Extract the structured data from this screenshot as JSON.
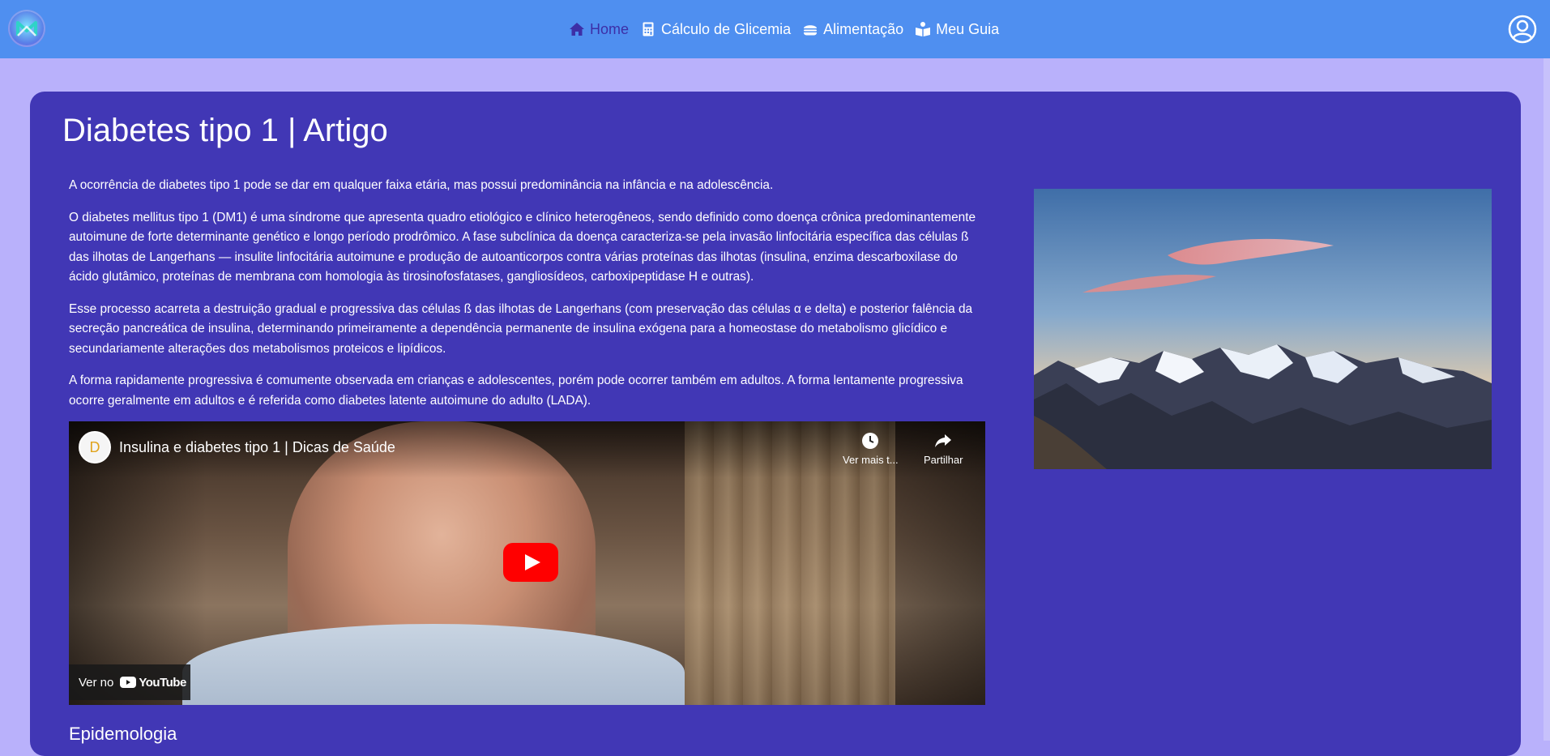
{
  "nav": {
    "items": [
      {
        "label": "Home",
        "icon": "home-icon",
        "active": true
      },
      {
        "label": "Cálculo de Glicemia",
        "icon": "calculator-icon",
        "active": false
      },
      {
        "label": "Alimentação",
        "icon": "burger-icon",
        "active": false
      },
      {
        "label": "Meu Guia",
        "icon": "guide-book-icon",
        "active": false
      }
    ],
    "logo_icon": "app-logo-icon",
    "profile_icon": "user-circle-icon"
  },
  "article": {
    "title": "Diabetes tipo 1 | Artigo",
    "paragraphs": [
      "A ocorrência de diabetes tipo 1 pode se dar em qualquer faixa etária, mas possui predominância na infância e na adolescência.",
      "O diabetes mellitus tipo 1 (DM1) é uma síndrome que apresenta quadro etiológico e clínico heterogêneos, sendo definido como doença crônica predominantemente autoimune de forte determinante genético e longo período prodrômico. A fase subclínica da doença caracteriza-se pela invasão linfocitária específica das células ß das ilhotas de Langerhans — insulite linfocitária autoimune e produção de autoanticorpos contra várias proteínas das ilhotas (insulina, enzima descarboxilase do ácido glutâmico, proteínas de membrana com homologia às tirosinofosfatases, gangliosídeos, carboxipeptidase H e outras).",
      "Esse processo acarreta a destruição gradual e progressiva das células ß das ilhotas de Langerhans (com preservação das células α e delta) e posterior falência da secreção pancreática de insulina, determinando primeiramente a dependência permanente de insulina exógena para a homeostase do metabolismo glicídico e secundariamente alterações dos metabolismos proteicos e lipídicos.",
      "A forma rapidamente progressiva é comumente observada em crianças e adolescentes, porém pode ocorrer também em adultos. A forma lentamente progressiva ocorre geralmente em adultos e é referida como diabetes latente autoimune do adulto (LADA)."
    ],
    "next_section": "Epidemologia"
  },
  "video": {
    "channel_initial": "D",
    "title": "Insulina e diabetes tipo 1 | Dicas de Saúde",
    "watch_later": "Ver mais t...",
    "share": "Partilhar",
    "watch_on": "Ver no",
    "platform": "YouTube"
  },
  "image": {
    "subject": "mountain-sunset-image"
  },
  "colors": {
    "navbar": "#4f8ff0",
    "page_bg": "#b9b1fb",
    "card_bg": "#4137b5",
    "active_nav": "#3d2fa7",
    "play_red": "#ff0000"
  }
}
